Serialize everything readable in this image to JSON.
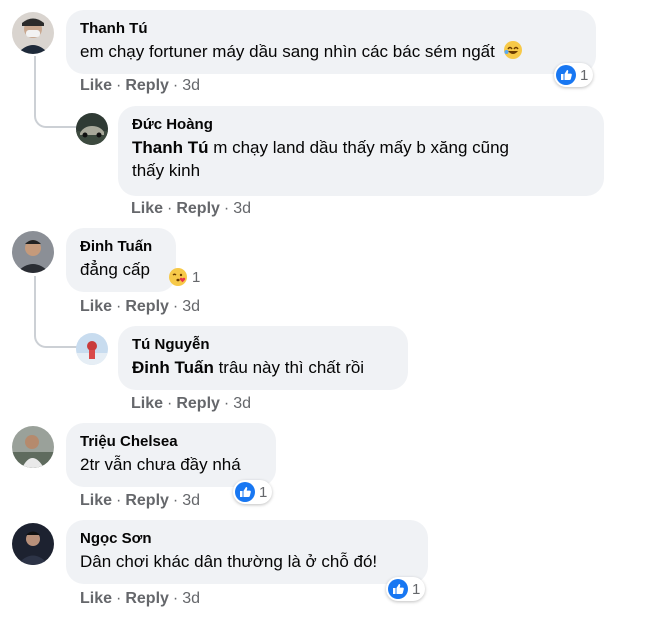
{
  "comments": [
    {
      "author": "Thanh Tú",
      "text": "em chạy fortuner máy dầu sang nhìn các bác sém ngất",
      "reaction": {
        "icon": "laugh-icon",
        "count_icon": "like-icon",
        "count": "1"
      },
      "actions": {
        "like": "Like",
        "reply": "Reply",
        "time": "3d"
      }
    },
    {
      "author": "Đức Hoàng",
      "tag": "Thanh Tú",
      "text_line1": " m chạy land dầu thấy mấy b xăng cũng",
      "text_line2": "thấy kinh",
      "actions": {
        "like": "Like",
        "reply": "Reply",
        "time": "3d"
      }
    },
    {
      "author": "Đinh Tuấn",
      "text": "đẳng cấp",
      "reaction": {
        "icon": "kiss-heart-icon",
        "count": "1"
      },
      "actions": {
        "like": "Like",
        "reply": "Reply",
        "time": "3d"
      }
    },
    {
      "author": "Tú Nguyễn",
      "tag": "Đinh Tuấn",
      "text": " trâu này thì chất rồi",
      "actions": {
        "like": "Like",
        "reply": "Reply",
        "time": "3d"
      }
    },
    {
      "author": "Triệu Chelsea",
      "text": "2tr vẫn chưa đầy nhá",
      "reaction": {
        "icon": "like-icon",
        "count": "1"
      },
      "actions": {
        "like": "Like",
        "reply": "Reply",
        "time": "3d"
      }
    },
    {
      "author": "Ngọc Sơn",
      "text": "Dân chơi khác dân thường là ở chỗ đó!",
      "reaction": {
        "icon": "like-icon",
        "count": "1"
      },
      "actions": {
        "like": "Like",
        "reply": "Reply",
        "time": "3d"
      }
    }
  ],
  "dot": "·",
  "colors": {
    "bubble": "#f0f2f5",
    "meta": "#65676b",
    "like_blue": "#1877f2"
  }
}
